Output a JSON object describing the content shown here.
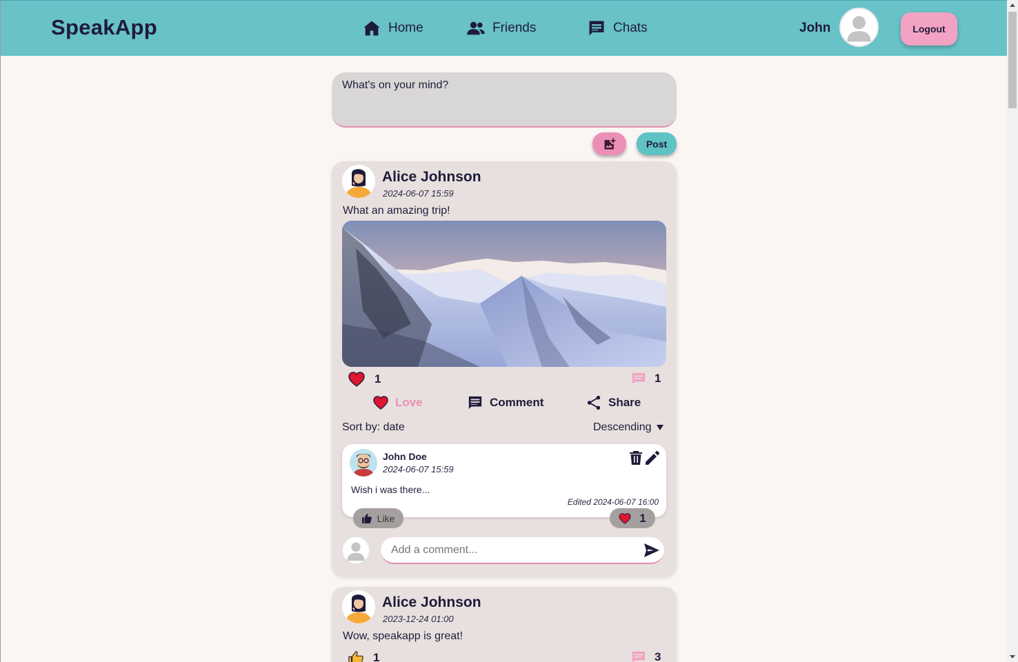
{
  "header": {
    "brand": "SpeakApp",
    "nav": [
      {
        "label": "Home",
        "icon": "home-icon"
      },
      {
        "label": "Friends",
        "icon": "people-icon"
      },
      {
        "label": "Chats",
        "icon": "chat-icon"
      }
    ],
    "user_name": "John",
    "logout_label": "Logout"
  },
  "composer": {
    "placeholder": "What's on your mind?",
    "post_label": "Post"
  },
  "posts": [
    {
      "author": "Alice Johnson",
      "date": "2024-06-07 15:59",
      "text": "What an amazing trip!",
      "love_count": "1",
      "comment_count": "1",
      "actions": {
        "love": "Love",
        "comment": "Comment",
        "share": "Share"
      },
      "sort_by": "Sort by: date",
      "sort_order": "Descending",
      "comments": [
        {
          "author": "John Doe",
          "date": "2024-06-07 15:59",
          "text": "Wish i was there...",
          "edited": "Edited 2024-06-07 16:00",
          "like_label": "Like",
          "love_count": "1"
        }
      ],
      "comment_input_placeholder": "Add a comment..."
    },
    {
      "author": "Alice Johnson",
      "date": "2023-12-24 01:00",
      "text": "Wow, speakapp is great!",
      "like_count": "1",
      "comment_count": "3"
    }
  ],
  "colors": {
    "header_bg": "#68c2c8",
    "accent_pink": "#f2a3c3",
    "card_bg": "#e7e0de",
    "heart_red": "#e0152f"
  }
}
